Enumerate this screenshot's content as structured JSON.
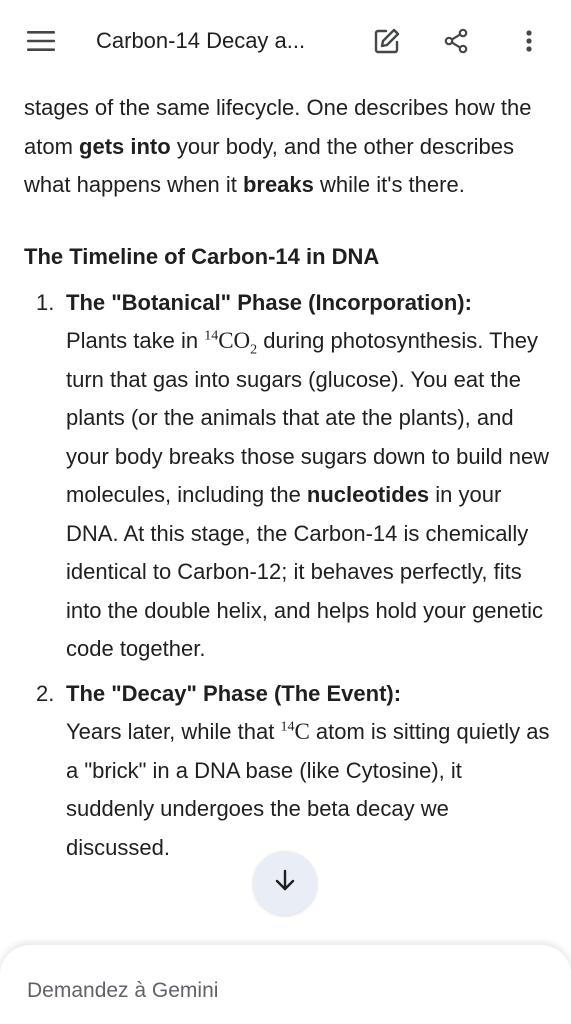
{
  "header": {
    "title": "Carbon-14 Decay a...",
    "menu_icon": "hamburger-menu-icon",
    "edit_icon": "edit-icon",
    "share_icon": "share-icon",
    "more_icon": "more-vert-icon"
  },
  "intro": {
    "t1": "stages of the same lifecycle. One describes how the atom ",
    "b1": "gets into",
    "t2": " your body, and the other describes what happens when it ",
    "b2": "breaks",
    "t3": " while it's there."
  },
  "section_heading": "The Timeline of Carbon-14 in DNA",
  "items": [
    {
      "number": "1.",
      "title": "The \"Botanical\" Phase (Incorporation):",
      "p1": "Plants take in ",
      "chem_sup": "14",
      "chem_base": "CO",
      "chem_sub": "2",
      "p2": " during photosynthesis. They turn that gas into sugars (glucose). You eat the plants (or the animals that ate the plants), and your body breaks those sugars down to build new molecules, including the ",
      "bold": "nucleotides",
      "p3": " in your DNA. At this stage, the Carbon-14 is chemically identical to Carbon-12; it behaves perfectly, fits into the double helix, and helps hold your genetic code together."
    },
    {
      "number": "2.",
      "title": "The \"Decay\" Phase (The Event):",
      "p1": "Years later, while that ",
      "chem_sup": "14",
      "chem_base": "C",
      "p2": " atom is sitting quietly as a \"brick\" in a DNA base (like Cytosine), it suddenly undergoes the beta decay we discussed."
    }
  ],
  "scroll_button": {
    "icon": "arrow-down-icon"
  },
  "input": {
    "placeholder": "Demandez à Gemini"
  }
}
